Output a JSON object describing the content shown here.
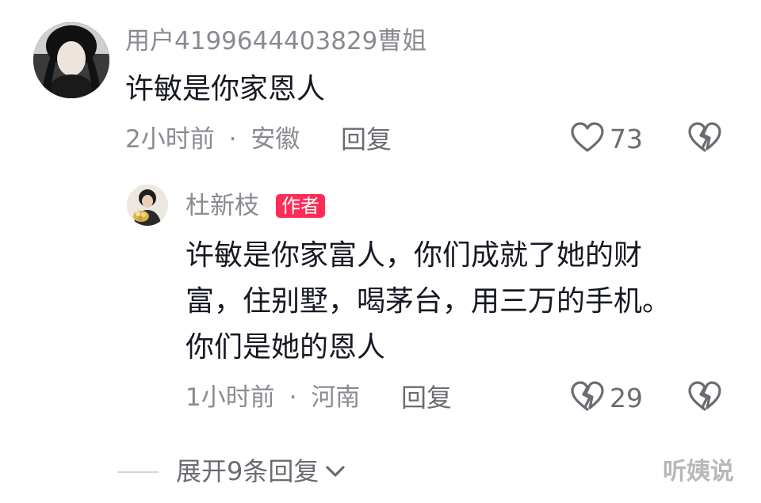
{
  "colors": {
    "primary_text": "#161823",
    "secondary_text": "#8a8b91",
    "action_text": "#6b6c72",
    "author_badge": "#fe2c55",
    "divider": "#d5d5d8"
  },
  "comment": {
    "username": "用户4199644403829曹姐",
    "text": "许敏是你家恩人",
    "time": "2小时前",
    "separator": "·",
    "location": "安徽",
    "reply_label": "回复",
    "like_icon": "heart-outline-icon",
    "like_count": "73",
    "dislike_icon": "broken-heart-icon"
  },
  "reply": {
    "username": "杜新枝",
    "badge": "作者",
    "text_lines": [
      "许敏是你家富人，你们成就了她的财",
      "富，住别墅，喝茅台，用三万的手机。",
      "你们是她的恩人"
    ],
    "time": "1小时前",
    "separator": "·",
    "location": "河南",
    "reply_label": "回复",
    "like_icon": "broken-heart-icon",
    "like_count": "29",
    "dislike_icon": "broken-heart-icon"
  },
  "expand": {
    "label": "展开9条回复",
    "icon": "chevron-down-icon"
  },
  "watermark": "听姨说"
}
